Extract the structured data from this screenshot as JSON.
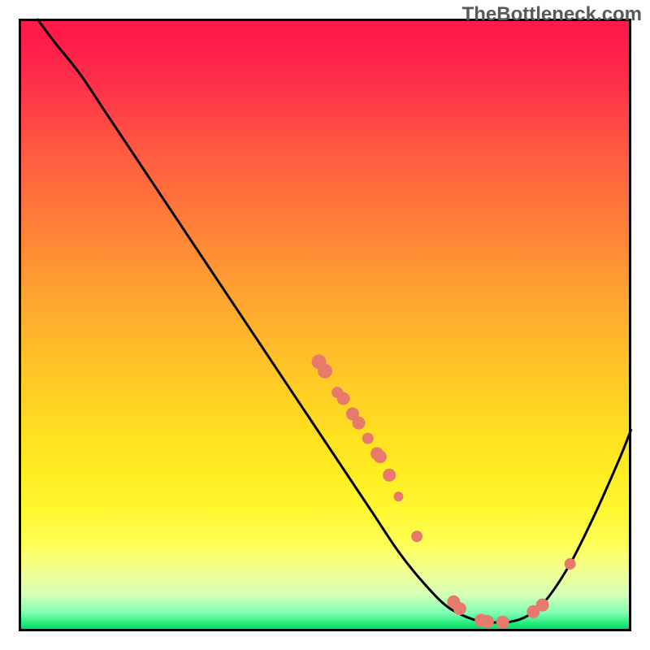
{
  "attribution": "TheBottleneck.com",
  "chart_data": {
    "type": "line",
    "title": "",
    "xlabel": "",
    "ylabel": "",
    "xlim": [
      0,
      100
    ],
    "ylim": [
      0,
      100
    ],
    "curve": [
      {
        "x": 3,
        "y": 100
      },
      {
        "x": 6,
        "y": 96
      },
      {
        "x": 10,
        "y": 91
      },
      {
        "x": 14,
        "y": 85
      },
      {
        "x": 18,
        "y": 79
      },
      {
        "x": 22,
        "y": 73
      },
      {
        "x": 26,
        "y": 67
      },
      {
        "x": 30,
        "y": 61
      },
      {
        "x": 34,
        "y": 55
      },
      {
        "x": 38,
        "y": 49
      },
      {
        "x": 42,
        "y": 43
      },
      {
        "x": 46,
        "y": 37
      },
      {
        "x": 50,
        "y": 31
      },
      {
        "x": 54,
        "y": 25
      },
      {
        "x": 58,
        "y": 19
      },
      {
        "x": 62,
        "y": 13
      },
      {
        "x": 66,
        "y": 8
      },
      {
        "x": 70,
        "y": 4
      },
      {
        "x": 74,
        "y": 2
      },
      {
        "x": 77,
        "y": 1.5
      },
      {
        "x": 80,
        "y": 1.5
      },
      {
        "x": 83,
        "y": 2.5
      },
      {
        "x": 86,
        "y": 5
      },
      {
        "x": 90,
        "y": 11
      },
      {
        "x": 94,
        "y": 19
      },
      {
        "x": 98,
        "y": 28
      },
      {
        "x": 100,
        "y": 33
      }
    ],
    "markers": [
      {
        "x": 49,
        "y": 44,
        "r": 9
      },
      {
        "x": 50,
        "y": 42.5,
        "r": 9
      },
      {
        "x": 52,
        "y": 39,
        "r": 7
      },
      {
        "x": 53,
        "y": 38,
        "r": 8
      },
      {
        "x": 54.5,
        "y": 35.5,
        "r": 8
      },
      {
        "x": 55.5,
        "y": 34,
        "r": 8
      },
      {
        "x": 57,
        "y": 31.5,
        "r": 7
      },
      {
        "x": 58.5,
        "y": 29,
        "r": 8
      },
      {
        "x": 59,
        "y": 28.5,
        "r": 8
      },
      {
        "x": 60.5,
        "y": 25.5,
        "r": 8
      },
      {
        "x": 62,
        "y": 22,
        "r": 6
      },
      {
        "x": 65,
        "y": 15.5,
        "r": 7
      },
      {
        "x": 71,
        "y": 4.8,
        "r": 8
      },
      {
        "x": 72,
        "y": 3.7,
        "r": 8
      },
      {
        "x": 75.5,
        "y": 1.8,
        "r": 8
      },
      {
        "x": 76.5,
        "y": 1.6,
        "r": 8
      },
      {
        "x": 79,
        "y": 1.5,
        "r": 8
      },
      {
        "x": 84,
        "y": 3.2,
        "r": 8
      },
      {
        "x": 85.5,
        "y": 4.3,
        "r": 8
      },
      {
        "x": 90,
        "y": 11,
        "r": 7
      }
    ]
  }
}
